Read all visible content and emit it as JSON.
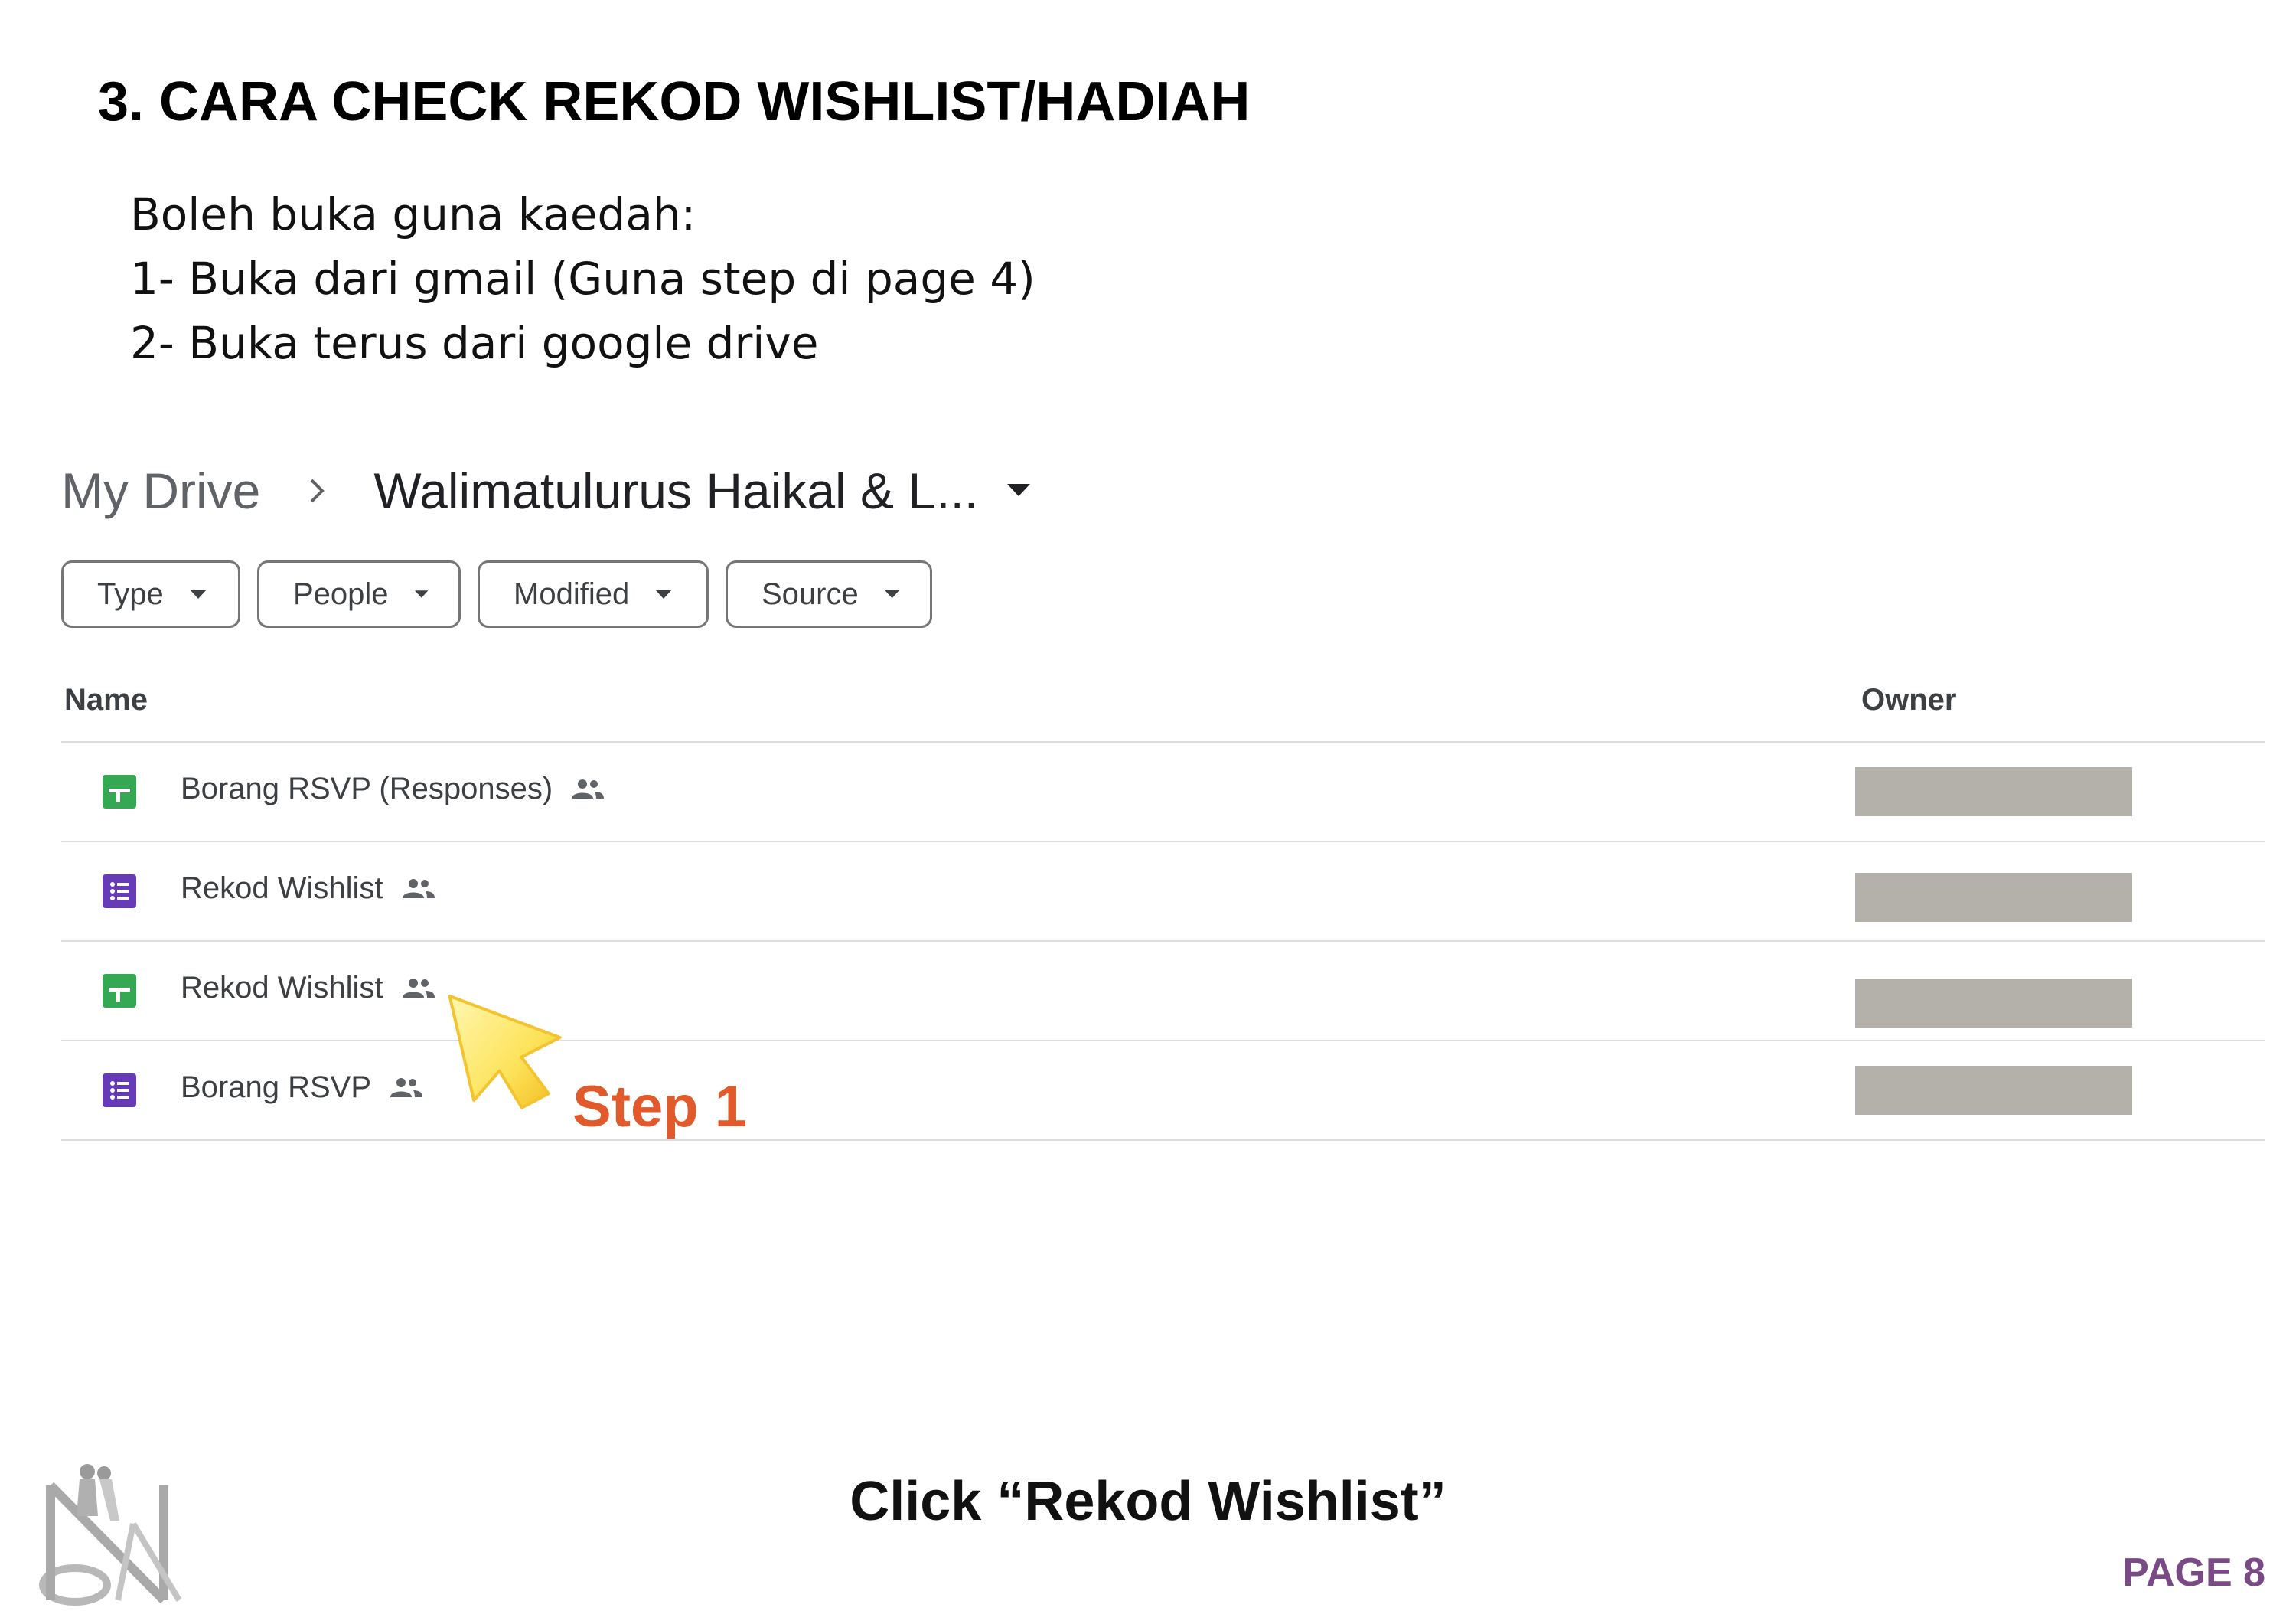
{
  "heading": "3. CARA CHECK REKOD WISHLIST/HADIAH",
  "intro": {
    "line1": "Boleh buka guna kaedah:",
    "line2": "1- Buka dari gmail (Guna step di page 4)",
    "line3": "2- Buka terus dari google drive"
  },
  "drive": {
    "breadcrumb": {
      "root": "My Drive",
      "separator_icon": "chevron-right-icon",
      "current": "Walimatulurus Haikal & L...",
      "caret_icon": "arrow-drop-down-icon"
    },
    "filters": [
      {
        "label": "Type"
      },
      {
        "label": "People"
      },
      {
        "label": "Modified"
      },
      {
        "label": "Source"
      }
    ],
    "columns": {
      "name": "Name",
      "owner": "Owner"
    },
    "files": [
      {
        "name": "Borang RSVP (Responses)",
        "type_icon": "google-sheets-icon",
        "shared_icon": "people-icon"
      },
      {
        "name": "Rekod Wishlist",
        "type_icon": "google-forms-icon",
        "shared_icon": "people-icon"
      },
      {
        "name": "Rekod Wishlist",
        "type_icon": "google-sheets-icon",
        "shared_icon": "people-icon"
      },
      {
        "name": "Borang RSVP",
        "type_icon": "google-forms-icon",
        "shared_icon": "people-icon"
      }
    ],
    "owner_redaction_color": "#b4b0aa"
  },
  "annotation": {
    "step_label": "Step 1",
    "pointer_icon": "cursor-arrow-icon",
    "step_color": "#e05a2b"
  },
  "instruction": "Click “Rekod Wishlist”",
  "page_label": "PAGE 8",
  "colors": {
    "sheets_green": "#34a853",
    "forms_purple": "#673ab7",
    "page_label": "#7a4a86"
  },
  "logo": {
    "monogram": "NA"
  }
}
